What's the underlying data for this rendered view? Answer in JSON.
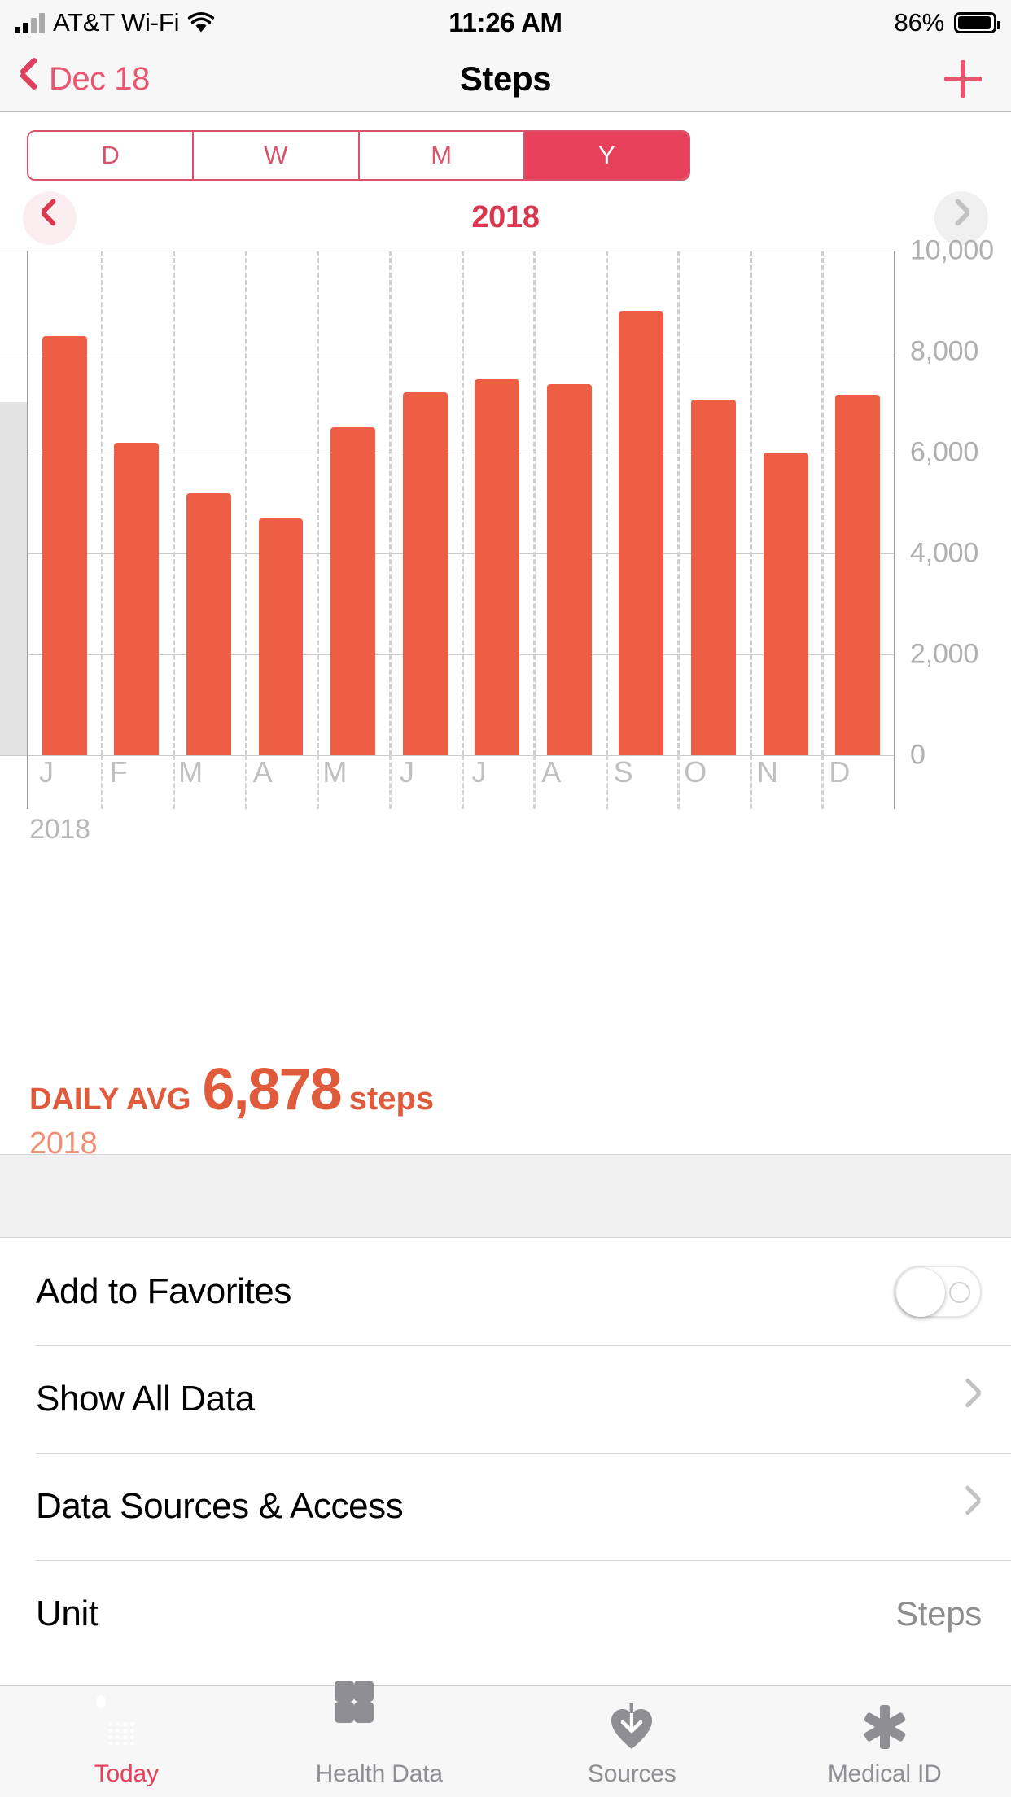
{
  "status_bar": {
    "carrier": "AT&T Wi-Fi",
    "time": "11:26 AM",
    "battery_percent": "86%",
    "signal_icon": "cellular-signal-icon",
    "wifi_icon": "wifi-icon",
    "battery_icon": "battery-icon"
  },
  "nav": {
    "back_label": "Dec 18",
    "title": "Steps",
    "add_icon": "plus-icon",
    "back_icon": "chevron-left-icon"
  },
  "segmented": {
    "options": [
      {
        "label": "D",
        "selected": false
      },
      {
        "label": "W",
        "selected": false
      },
      {
        "label": "M",
        "selected": false
      },
      {
        "label": "Y",
        "selected": true
      }
    ],
    "selected_color": "#e8415c",
    "tint_color": "#d9536b"
  },
  "period_nav": {
    "title": "2018",
    "prev_icon": "chevron-left-icon",
    "next_icon": "chevron-right-icon",
    "prev_enabled": true,
    "next_enabled": false
  },
  "chart_data": {
    "type": "bar",
    "title": "",
    "xlabel": "2018",
    "ylabel": "",
    "categories": [
      "J",
      "F",
      "M",
      "A",
      "M",
      "J",
      "J",
      "A",
      "S",
      "O",
      "N",
      "D"
    ],
    "category_names": [
      "January",
      "February",
      "March",
      "April",
      "May",
      "June",
      "July",
      "August",
      "September",
      "October",
      "November",
      "December"
    ],
    "values": [
      8300,
      6200,
      5200,
      4700,
      6500,
      7200,
      7450,
      7350,
      8800,
      7050,
      6000,
      7150
    ],
    "ghost_value": 7000,
    "ghost_label": "previous period (partially visible)",
    "ylim": [
      0,
      10000
    ],
    "yticks": [
      0,
      2000,
      4000,
      6000,
      8000,
      10000
    ],
    "ytick_labels": [
      "0",
      "2,000",
      "4,000",
      "6,000",
      "8,000",
      "10,000"
    ],
    "grid": true,
    "legend": "none",
    "bar_color": "#ee5e45",
    "ghost_color": "#e3e3e3",
    "axis_label_color": "#b8b8b8",
    "axis_footer": "2018"
  },
  "summary": {
    "label": "DAILY AVG",
    "value": "6,878",
    "unit": "steps",
    "period": "2018",
    "color": "#e05a3c"
  },
  "settings": {
    "rows": [
      {
        "label": "Add to Favorites",
        "control": "toggle",
        "value": "",
        "toggle_on": false
      },
      {
        "label": "Show All Data",
        "control": "chevron",
        "value": ""
      },
      {
        "label": "Data Sources & Access",
        "control": "chevron",
        "value": ""
      },
      {
        "label": "Unit",
        "control": "value",
        "value": "Steps"
      }
    ]
  },
  "tab_bar": {
    "tabs": [
      {
        "label": "Today",
        "icon": "calendar-icon",
        "active": true
      },
      {
        "label": "Health Data",
        "icon": "grid-squares-icon",
        "active": false
      },
      {
        "label": "Sources",
        "icon": "heart-download-icon",
        "active": false
      },
      {
        "label": "Medical ID",
        "icon": "medical-asterisk-icon",
        "active": false
      }
    ],
    "active_color": "#e8415c",
    "inactive_color": "#8e8e93"
  }
}
